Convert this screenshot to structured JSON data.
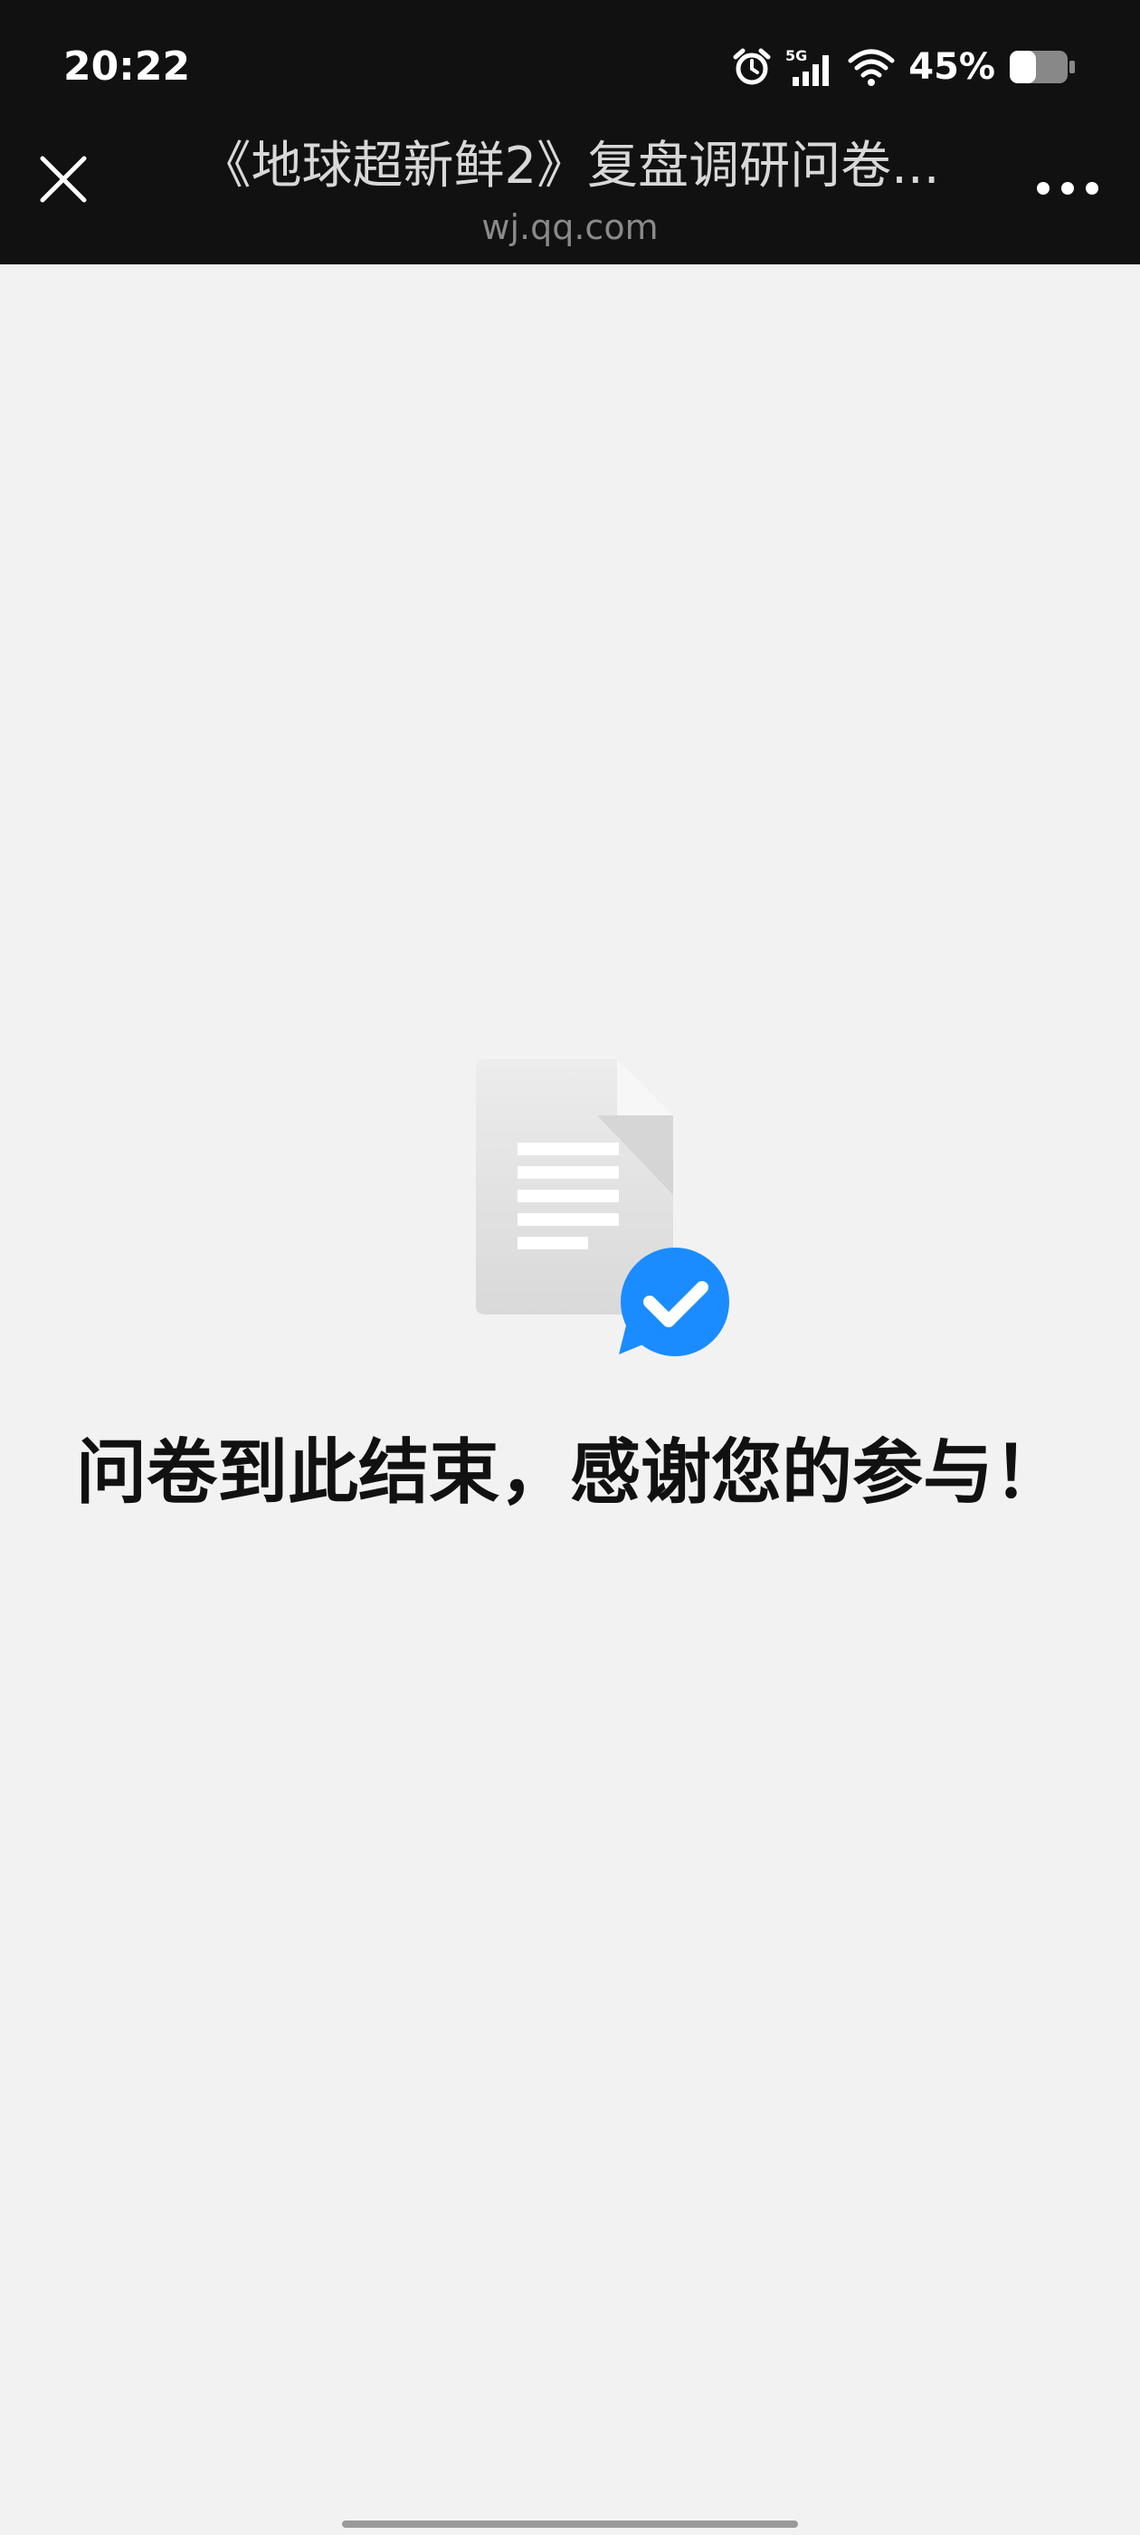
{
  "status_bar": {
    "time": "20:22",
    "network": "5G",
    "battery_pct": "45%",
    "battery_level": 0.45,
    "icons": [
      "alarm-icon",
      "signal-icon",
      "wifi-icon",
      "battery-icon"
    ]
  },
  "nav": {
    "title": "《地球超新鲜2》复盘调研问卷...",
    "url": "wj.qq.com",
    "close_icon": "close-icon",
    "more_icon": "more-icon"
  },
  "content": {
    "message": "问卷到此结束，感谢您的参与！",
    "illustration_icon": "document-check-icon"
  },
  "colors": {
    "top_bar": "#111111",
    "page_bg": "#f2f2f2",
    "accent_blue": "#1a8cff",
    "text": "#111111"
  }
}
